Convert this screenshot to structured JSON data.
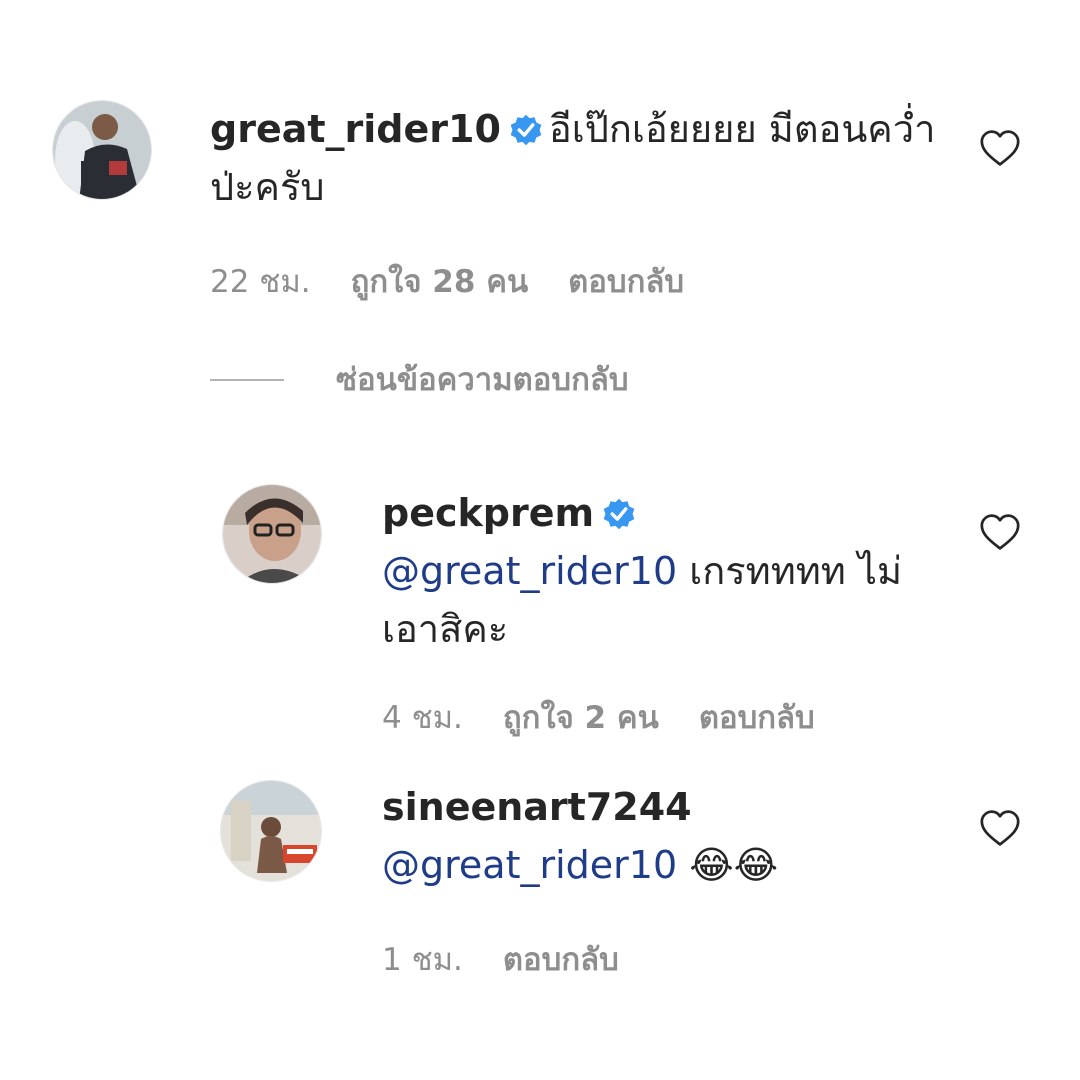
{
  "comments": [
    {
      "username": "great_rider10",
      "verified": true,
      "text": "อีเป๊กเอ้ยยยย มีตอนคว่ำป่ะครับ",
      "time": "22 ชม.",
      "likes": "ถูกใจ 28 คน",
      "reply": "ตอบกลับ"
    }
  ],
  "hide_replies_label": "ซ่อนข้อความตอบกลับ",
  "replies": [
    {
      "username": "peckprem",
      "verified": true,
      "mention": "@great_rider10",
      "text": "เกรทททท ไม่เอาสิคะ",
      "time": "4 ชม.",
      "likes": "ถูกใจ 2 คน",
      "reply": "ตอบกลับ"
    },
    {
      "username": "sineenart7244",
      "verified": false,
      "mention": "@great_rider10",
      "text": "😂😂",
      "time": "1 ชม.",
      "reply": "ตอบกลับ"
    }
  ],
  "icons": {
    "verified": "verified-badge-icon",
    "like": "heart-outline-icon"
  },
  "colors": {
    "verified": "#3897f0",
    "mention": "#1f3c88",
    "meta": "#8e8e8e",
    "text": "#262626"
  }
}
